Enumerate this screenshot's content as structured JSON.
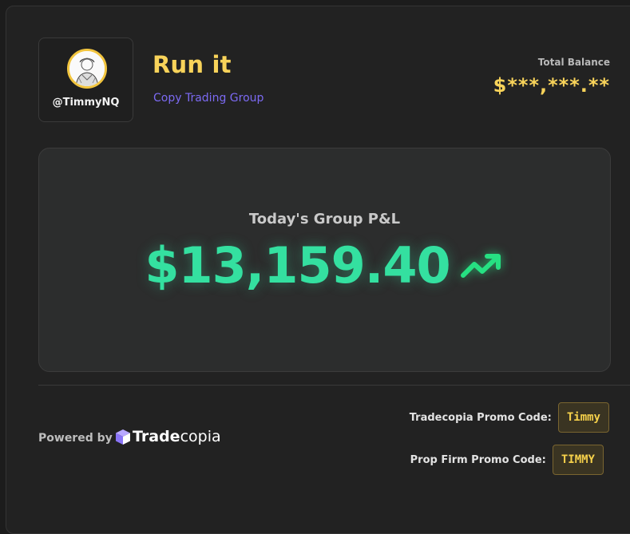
{
  "profile": {
    "handle": "@TimmyNQ",
    "avatar_icon": "avatar-sketch-icon"
  },
  "group": {
    "title": "Run it",
    "subtitle": "Copy Trading Group"
  },
  "balance": {
    "label": "Total Balance",
    "value": "$***,***.**"
  },
  "pnl": {
    "label": "Today's Group P&L",
    "value": "$13,159.40",
    "trend_icon": "trending-up-icon"
  },
  "footer": {
    "powered_by": "Powered by",
    "brand_bold": "Trade",
    "brand_light": "copia",
    "promos": [
      {
        "label": "Tradecopia Promo Code:",
        "code": "Timmy"
      },
      {
        "label": "Prop Firm Promo Code:",
        "code": "TIMMY"
      }
    ]
  },
  "colors": {
    "accent_yellow": "#f8d35a",
    "accent_purple": "#7c6af3",
    "profit_green": "#34e0a0"
  }
}
